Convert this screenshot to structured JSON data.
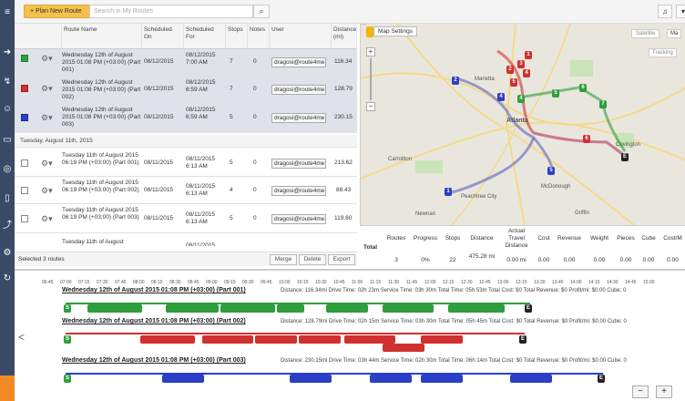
{
  "toolbar": {
    "plan_label": "+ Plan New Route",
    "search_placeholder": "Search in My Routes"
  },
  "columns": {
    "name": "Route Name",
    "sched_on": "Scheduled On",
    "sched_for": "Scheduled For",
    "stops": "Stops",
    "notes": "Notes",
    "user": "User",
    "distance": "Distance (mi)"
  },
  "rows": [
    {
      "name": "Wednesday 12th of August 2015 01:08 PM (+03:00) (Part 001)",
      "on": "08/12/2015",
      "for": "08/12/2015 7:00 AM",
      "stops": "7",
      "notes": "0",
      "user": "dragosi@route4me",
      "dist": "116.34",
      "color": "green"
    },
    {
      "name": "Wednesday 12th of August 2015 01:08 PM (+03:00) (Part 002)",
      "on": "08/12/2015",
      "for": "08/12/2015 6:59 AM",
      "stops": "7",
      "notes": "0",
      "user": "dragosi@route4me",
      "dist": "128.79",
      "color": "red"
    },
    {
      "name": "Wednesday 12th of August 2015 01:08 PM (+03:00) (Part 003)",
      "on": "08/12/2015",
      "for": "08/12/2015 6:59 AM",
      "stops": "5",
      "notes": "0",
      "user": "dragosi@route4me",
      "dist": "230.15",
      "color": "blue"
    }
  ],
  "group_label": "Tuesday, August 11th, 2015",
  "rows2": [
    {
      "name": "Tuesday 11th of August 2015 06:19 PM (+03:00) (Part 001)",
      "on": "08/11/2015",
      "for": "08/11/2015 6:13 AM",
      "stops": "5",
      "notes": "0",
      "user": "dragosi@route4me",
      "dist": "213.62"
    },
    {
      "name": "Tuesday 11th of August 2015 06:19 PM (+03:00) (Part 002)",
      "on": "08/11/2015",
      "for": "08/11/2015 6:13 AM",
      "stops": "4",
      "notes": "0",
      "user": "dragosi@route4me",
      "dist": "88.43"
    },
    {
      "name": "Tuesday 11th of August 2015 06:19 PM (+03:00) (Part 003)",
      "on": "08/11/2015",
      "for": "08/11/2015 6:13 AM",
      "stops": "5",
      "notes": "0",
      "user": "dragosi@route4me",
      "dist": "119.80"
    },
    {
      "name": "Tuesday 11th of August",
      "on": "",
      "for": "08/11/2015",
      "stops": "",
      "notes": "",
      "user": "",
      "dist": ""
    }
  ],
  "footer": {
    "selected": "Selected 3 routes",
    "merge": "Merge",
    "delete": "Delete",
    "export": "Export"
  },
  "map": {
    "settings": "Map Settings",
    "satellite": "Satellite",
    "map_tab": "Ma",
    "tracking": "Tracking",
    "atlanta": "Atlanta",
    "marietta": "Marietta",
    "mcdonough": "McDonough",
    "peachtree": "Peachtree City",
    "carrollton": "Carrollton",
    "covington": "Covington",
    "newnan": "Newnan",
    "griffin": "Griffin"
  },
  "totals": {
    "label": "Total",
    "h_routes": "Routes",
    "h_progress": "Progress",
    "h_stops": "Stops",
    "h_distance": "Distance",
    "h_actual": "Actual Travel Distance",
    "h_cost": "Cost",
    "h_revenue": "Revenue",
    "h_weight": "Weight",
    "h_pieces": "Pieces",
    "h_cube": "Cube",
    "h_costm": "Cost/M",
    "v_routes": "3",
    "v_progress": "0%",
    "v_stops": "22",
    "v_distance": "475.28 mi",
    "v_actual": "0.00 mi",
    "v_cost": "0.00",
    "v_revenue": "0.00",
    "v_weight": "0.00",
    "v_pieces": "0.00",
    "v_cube": "0.00",
    "v_costm": "0.00"
  },
  "ticks": [
    "06:45",
    "07:00",
    "07:15",
    "07:30",
    "07:45",
    "08:00",
    "08:15",
    "08:30",
    "08:45",
    "09:00",
    "09:15",
    "09:30",
    "09:45",
    "10:00",
    "10:15",
    "10:30",
    "10:45",
    "11:00",
    "11:15",
    "11:30",
    "11:45",
    "12:00",
    "12:15",
    "12:30",
    "12:45",
    "13:00",
    "13:15",
    "13:30",
    "13:45",
    "14:00",
    "14:15",
    "14:30",
    "14:45",
    "15:00"
  ],
  "timeline": [
    {
      "title": "Wednesday 12th of August 2015 01:08 PM (+03:00) (Part 001)",
      "info": "Distance: 116.34mi   Drive Time: 02h 23m   Service Time: 03h 30m   Total Time: 05h 53m   Total Cost: $0   Total Revenue: $0   Profit/mi: $0.00   Cube: 0"
    },
    {
      "title": "Wednesday 12th of August 2015 01:08 PM (+03:00) (Part 002)",
      "info": "Distance: 128.79mi   Drive Time: 02h 15m   Service Time: 03h 30m   Total Time: 05h 45m   Total Cost: $0   Total Revenue: $0   Profit/mi: $0.00   Cube: 0"
    },
    {
      "title": "Wednesday 12th of August 2015 01:08 PM (+03:00) (Part 003)",
      "info": "Distance: 230.15mi   Drive Time: 03h 44m   Service Time: 02h 30m   Total Time: 06h 14m   Total Cost: $0   Total Revenue: $0   Profit/mi: $0.00   Cube: 0"
    }
  ],
  "colors": {
    "green": "#2e9e3e",
    "red": "#d03030",
    "blue": "#2a3fc8",
    "dark": "#222222"
  }
}
